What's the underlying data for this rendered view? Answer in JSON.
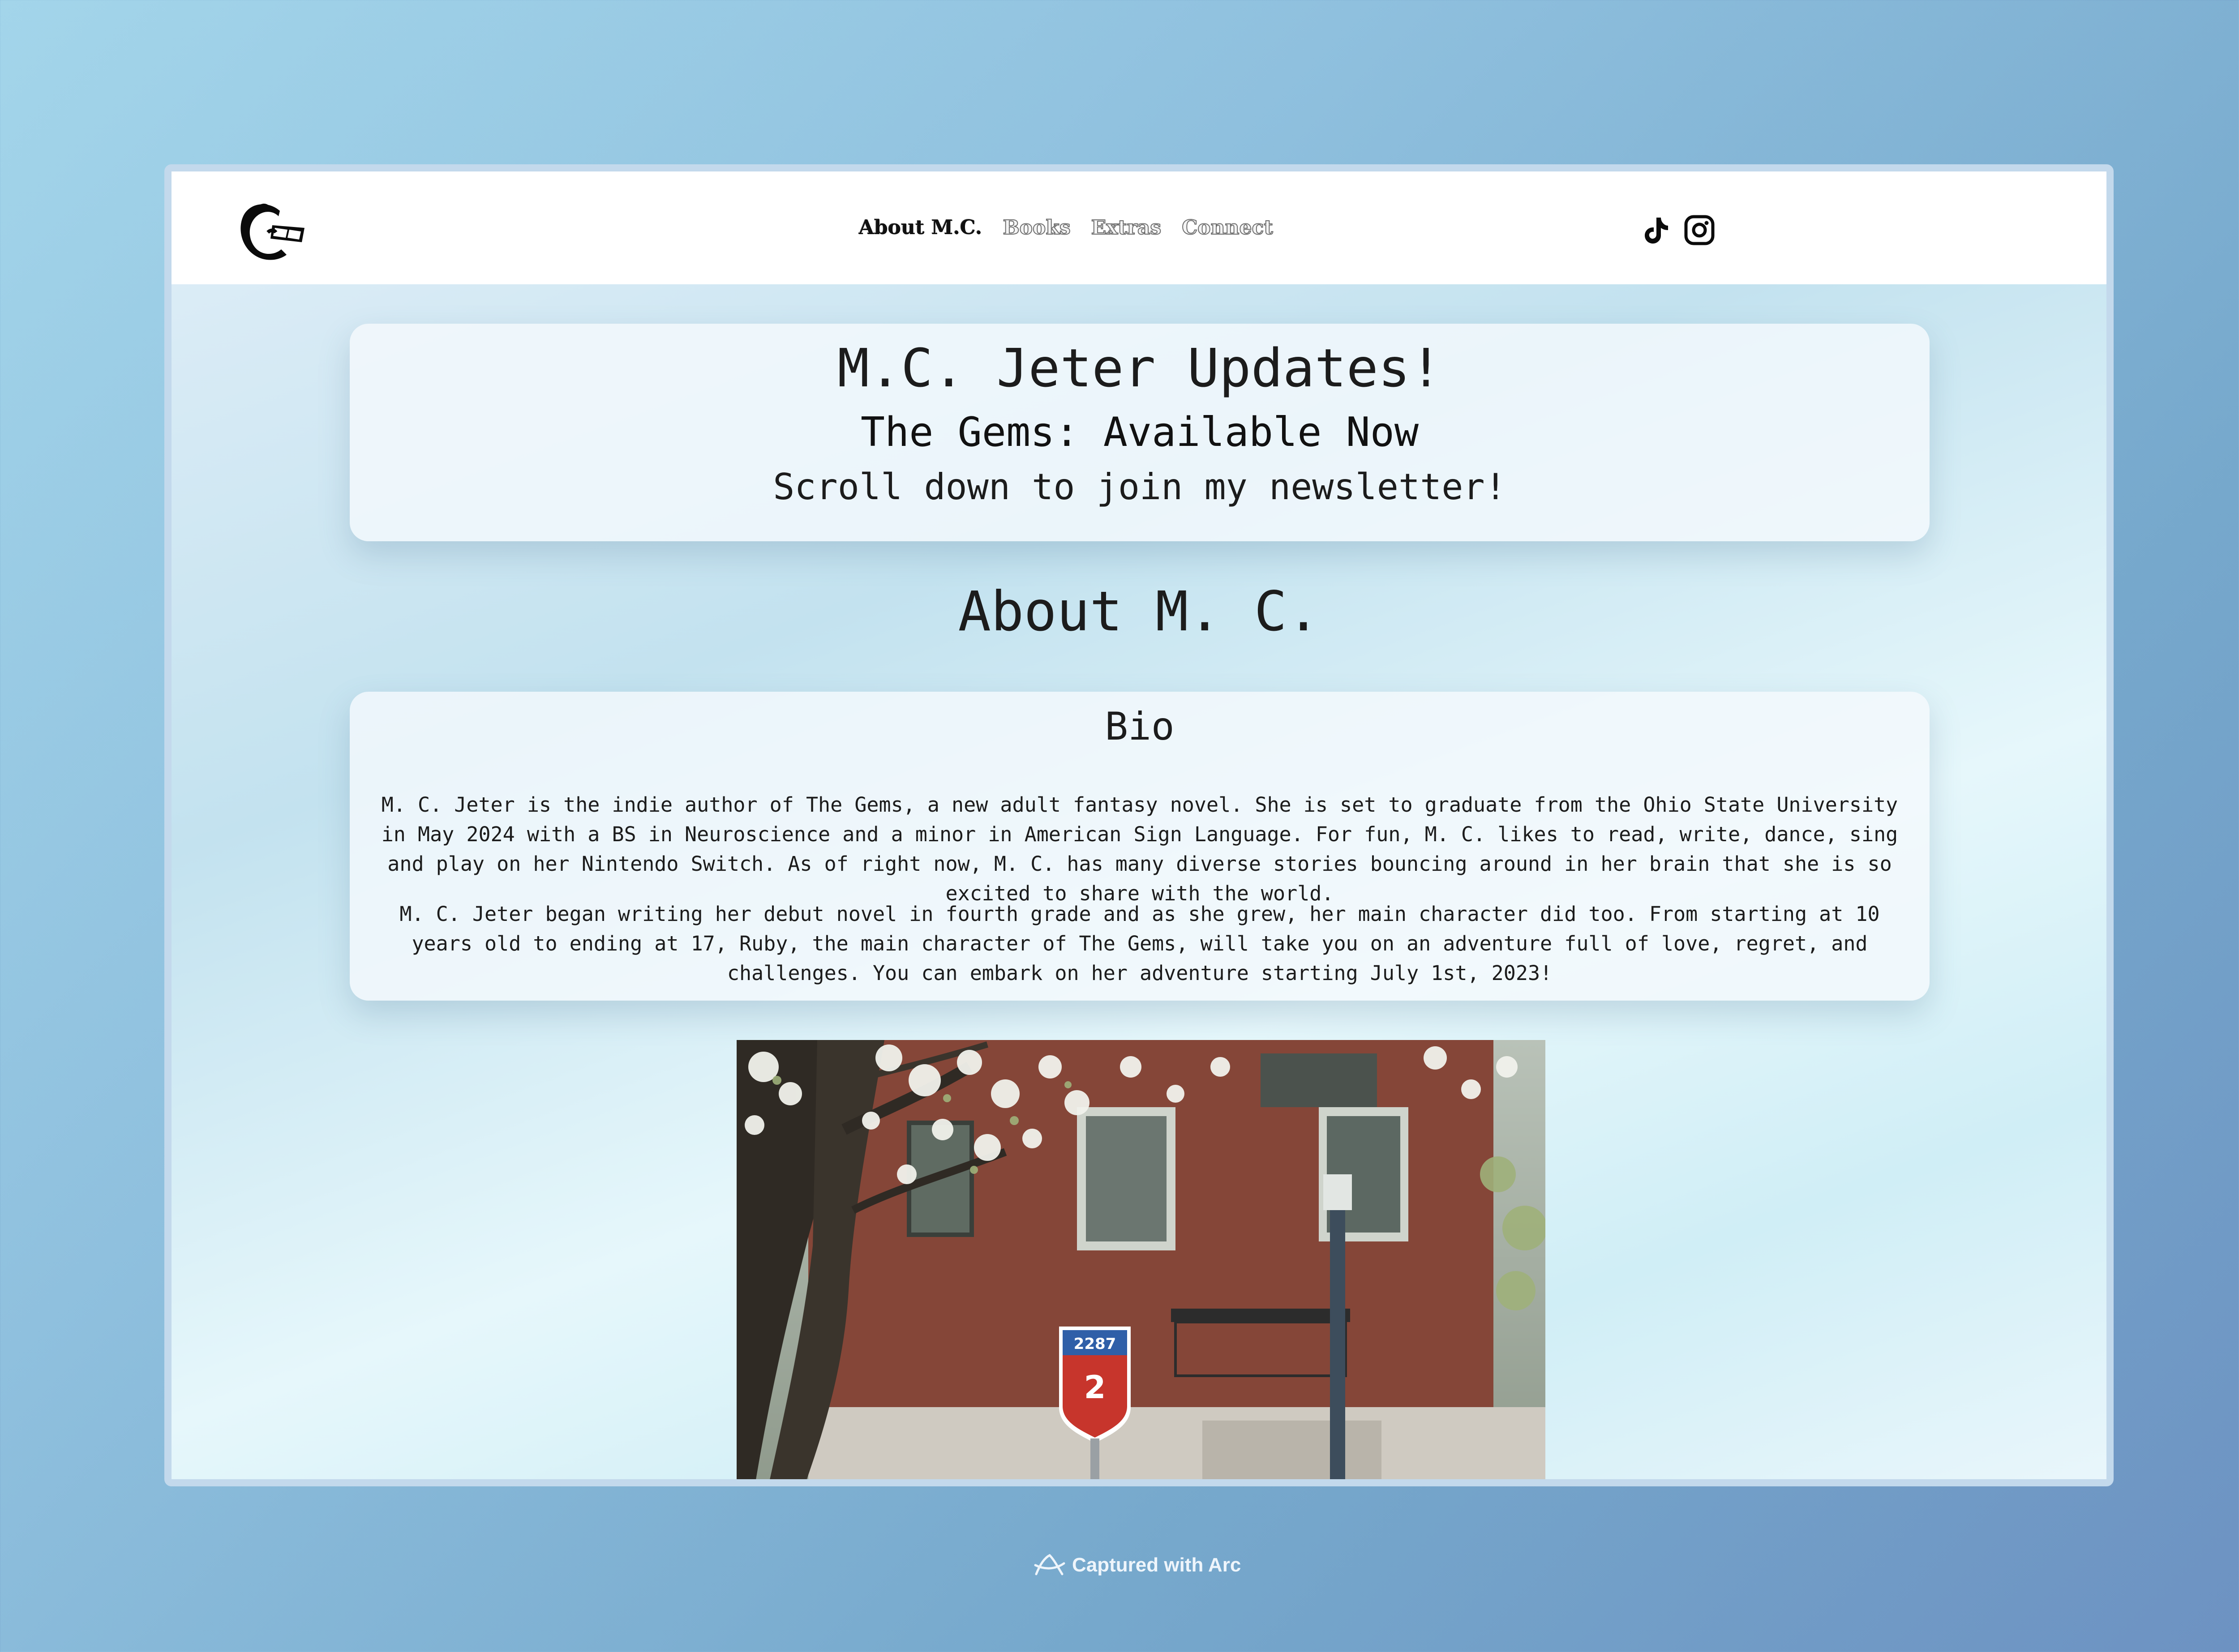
{
  "nav": {
    "logo_icon": "reading-dolphin-logo-icon",
    "links": [
      {
        "label": "About M.C.",
        "active": true
      },
      {
        "label": "Books",
        "active": false
      },
      {
        "label": "Extras",
        "active": false
      },
      {
        "label": "Connect",
        "active": false
      }
    ],
    "social": [
      "tiktok-icon",
      "instagram-icon"
    ]
  },
  "updates": {
    "title": "M.C. Jeter Updates!",
    "subtitle": "The Gems: Available Now",
    "cta": "Scroll down to join my newsletter!"
  },
  "about": {
    "heading": "About M. C.",
    "bio_title": "Bio",
    "paragraphs": [
      "M. C. Jeter is the indie author of The Gems, a new adult fantasy novel. She is set to graduate from the Ohio State University in May 2024 with a BS in Neuroscience and a minor in American Sign Language. For fun, M. C. likes to read, write, dance, sing and play on her Nintendo Switch. As of right now, M. C. has many diverse stories bouncing around in her brain that she is so excited to share with the world.",
      "M. C. Jeter began writing her debut novel in fourth grade and as she grew, her main character did too. From starting at 10 years old to ending at 17, Ruby, the main character of The Gems, will take you on an adventure full of love, regret, and challenges. You can embark on her adventure starting July 1st, 2023!"
    ]
  },
  "photo": {
    "sign_number": "2287",
    "sign_digit": "2"
  },
  "footer": {
    "capture_text": "Captured with Arc",
    "arc_icon": "arc-logo-icon"
  },
  "colors": {
    "nav_bg": "#ffffff",
    "text": "#1c1c1c",
    "card_bg": "#f4f9fd",
    "window_border": "#c3d9ec"
  }
}
